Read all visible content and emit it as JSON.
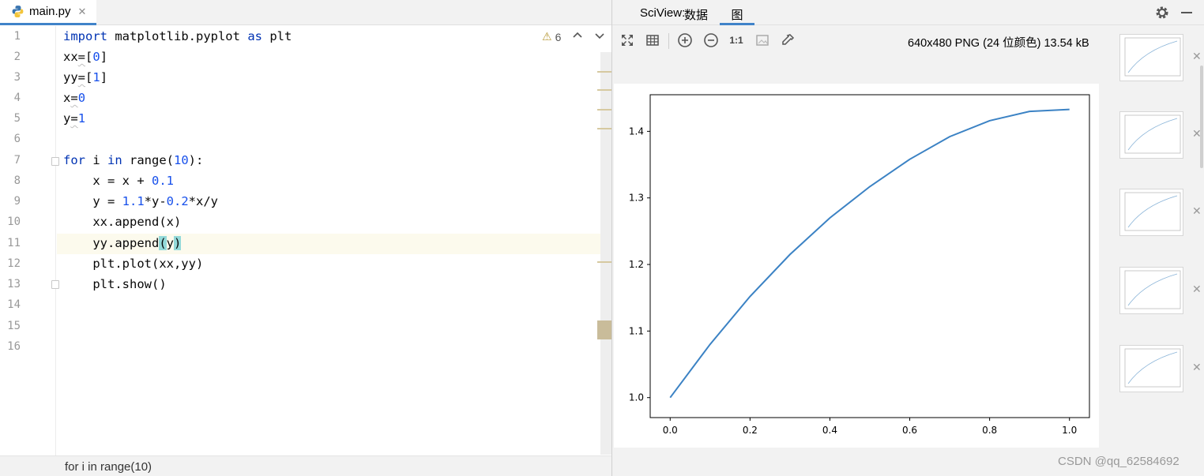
{
  "editor": {
    "tab_label": "main.py",
    "inspection_count": "6",
    "breadcrumb": "for i in range(10)",
    "line_numbers": [
      "1",
      "2",
      "3",
      "4",
      "5",
      "6",
      "7",
      "8",
      "9",
      "10",
      "11",
      "12",
      "13",
      "14",
      "15",
      "16"
    ]
  },
  "sciview": {
    "title": "SciView:",
    "tab_data": "数据",
    "tab_plots": "图",
    "image_info": "640x480 PNG (24 位颜色) 13.54 kB",
    "zoom_actual_label": "1:1"
  },
  "watermark": "CSDN @qq_62584692",
  "colors": {
    "accent": "#4083c9",
    "line": "#3b82c4",
    "keyword": "#0033b3",
    "number": "#1750eb"
  },
  "chart_data": {
    "type": "line",
    "xlim": [
      -0.05,
      1.05
    ],
    "ylim": [
      0.97,
      1.455
    ],
    "xticks": [
      0.0,
      0.2,
      0.4,
      0.6,
      0.8,
      1.0
    ],
    "xtick_labels": [
      "0.0",
      "0.2",
      "0.4",
      "0.6",
      "0.8",
      "1.0"
    ],
    "yticks": [
      1.0,
      1.1,
      1.2,
      1.3,
      1.4
    ],
    "ytick_labels": [
      "1.0",
      "1.1",
      "1.2",
      "1.3",
      "1.4"
    ],
    "grid": false,
    "series": [
      {
        "x": [
          0.0,
          0.1,
          0.2,
          0.3,
          0.4,
          0.5,
          0.6,
          0.7,
          0.8,
          0.9,
          1.0
        ],
        "y": [
          1.0,
          1.08,
          1.152,
          1.215,
          1.27,
          1.317,
          1.358,
          1.392,
          1.416,
          1.43,
          1.433
        ]
      }
    ]
  }
}
